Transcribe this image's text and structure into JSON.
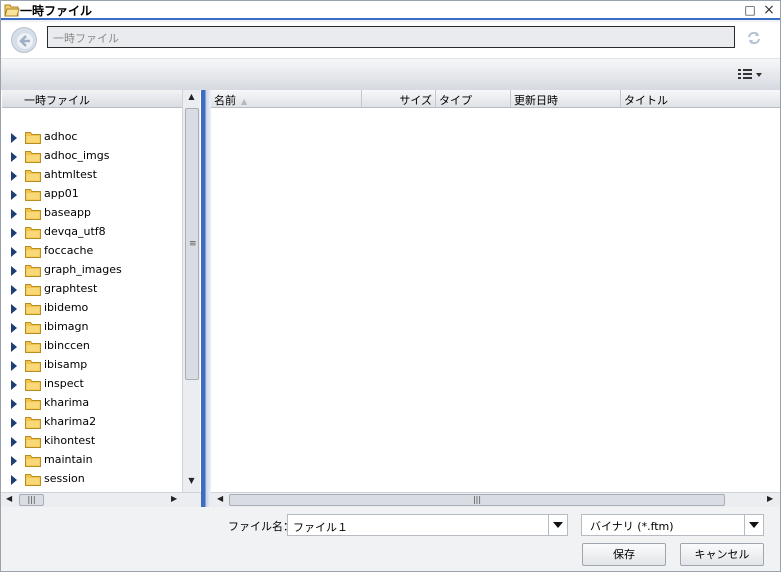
{
  "window": {
    "title": "一時ファイル"
  },
  "address": {
    "path": "一時ファイル"
  },
  "left": {
    "header": "一時ファイル",
    "folders": [
      "adhoc",
      "adhoc_imgs",
      "ahtmltest",
      "app01",
      "baseapp",
      "devqa_utf8",
      "foccache",
      "graph_images",
      "graphtest",
      "ibidemo",
      "ibimagn",
      "ibinccen",
      "ibisamp",
      "inspect",
      "kharima",
      "kharima2",
      "kihontest",
      "maintain",
      "session"
    ]
  },
  "columns": {
    "name": "名前",
    "size": "サイズ",
    "type": "タイプ",
    "date": "更新日時",
    "title": "タイトル"
  },
  "footer": {
    "filename_label": "ファイル名：",
    "filename_value": "ファイル１",
    "filetype": "バイナリ (*.ftm)",
    "save": "保存",
    "cancel": "キャンセル"
  },
  "colors": {
    "accent": "#3b6dc2",
    "folder": "#f2c44b"
  }
}
